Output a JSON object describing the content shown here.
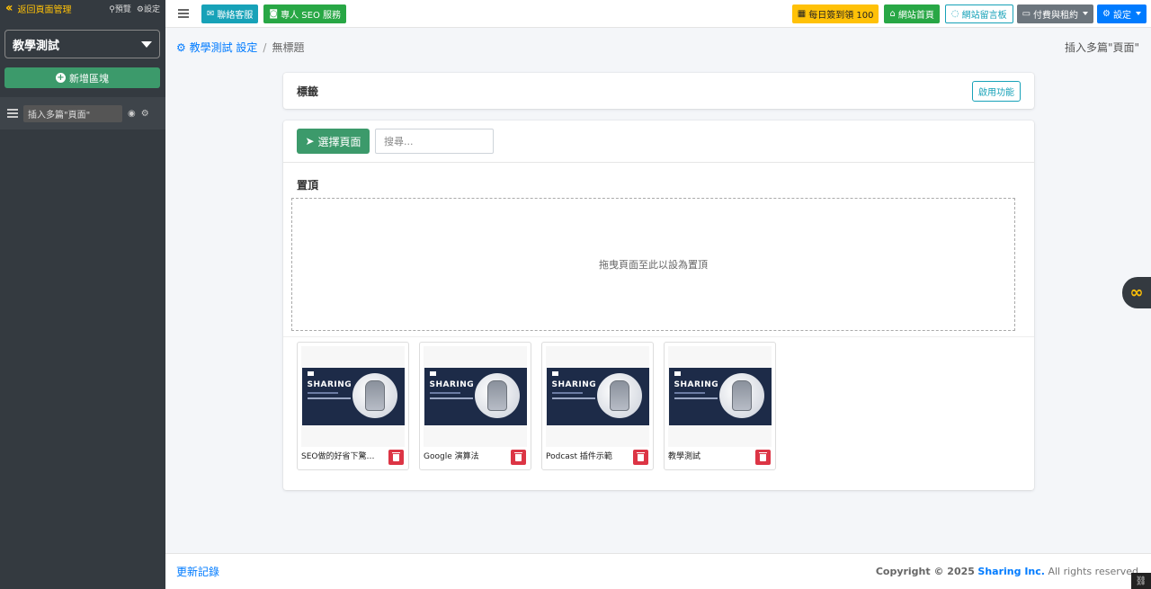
{
  "sidebar": {
    "back_label": "返回頁面管理",
    "preview_label": "預覽",
    "settings_label": "設定",
    "site_select": "教學測試",
    "add_block_label": "新增區塊",
    "block_name": "插入多篇\"頁面\""
  },
  "topbar": {
    "contact_label": "聯絡客服",
    "seo_label": "專人 SEO 服務",
    "checkin_label": "每日簽到領 100",
    "home_label": "網站首頁",
    "guestbook_label": "網站留言板",
    "billing_label": "付費與租約",
    "settings_label": "設定"
  },
  "breadcrumb": {
    "settings_link": "教學測試 設定",
    "separator": "/",
    "current": "無標題"
  },
  "page_right_title": "插入多篇\"頁面\"",
  "tags_card": {
    "title": "標籤",
    "enable_label": "啟用功能"
  },
  "pages_card": {
    "select_label": "選擇頁面",
    "search_placeholder": "搜尋...",
    "pinned_label": "置頂",
    "dropzone_text": "拖曳頁面至此以設為置頂",
    "thumb_brand": "SHARING",
    "pages": [
      {
        "label": "SEO做的好省下驚人..."
      },
      {
        "label": "Google 演算法"
      },
      {
        "label": "Podcast 插件示範"
      },
      {
        "label": "教學測試"
      }
    ]
  },
  "footer": {
    "changelog_label": "更新記錄",
    "copyright_prefix": "Copyright © 2025",
    "company": "Sharing Inc.",
    "rights": "All rights reserved"
  },
  "colors": {
    "sidebar_bg": "#343a40",
    "accent_green": "#3c9a6b",
    "link_blue": "#007bff",
    "danger": "#dc3545",
    "warning": "#ffc107"
  }
}
